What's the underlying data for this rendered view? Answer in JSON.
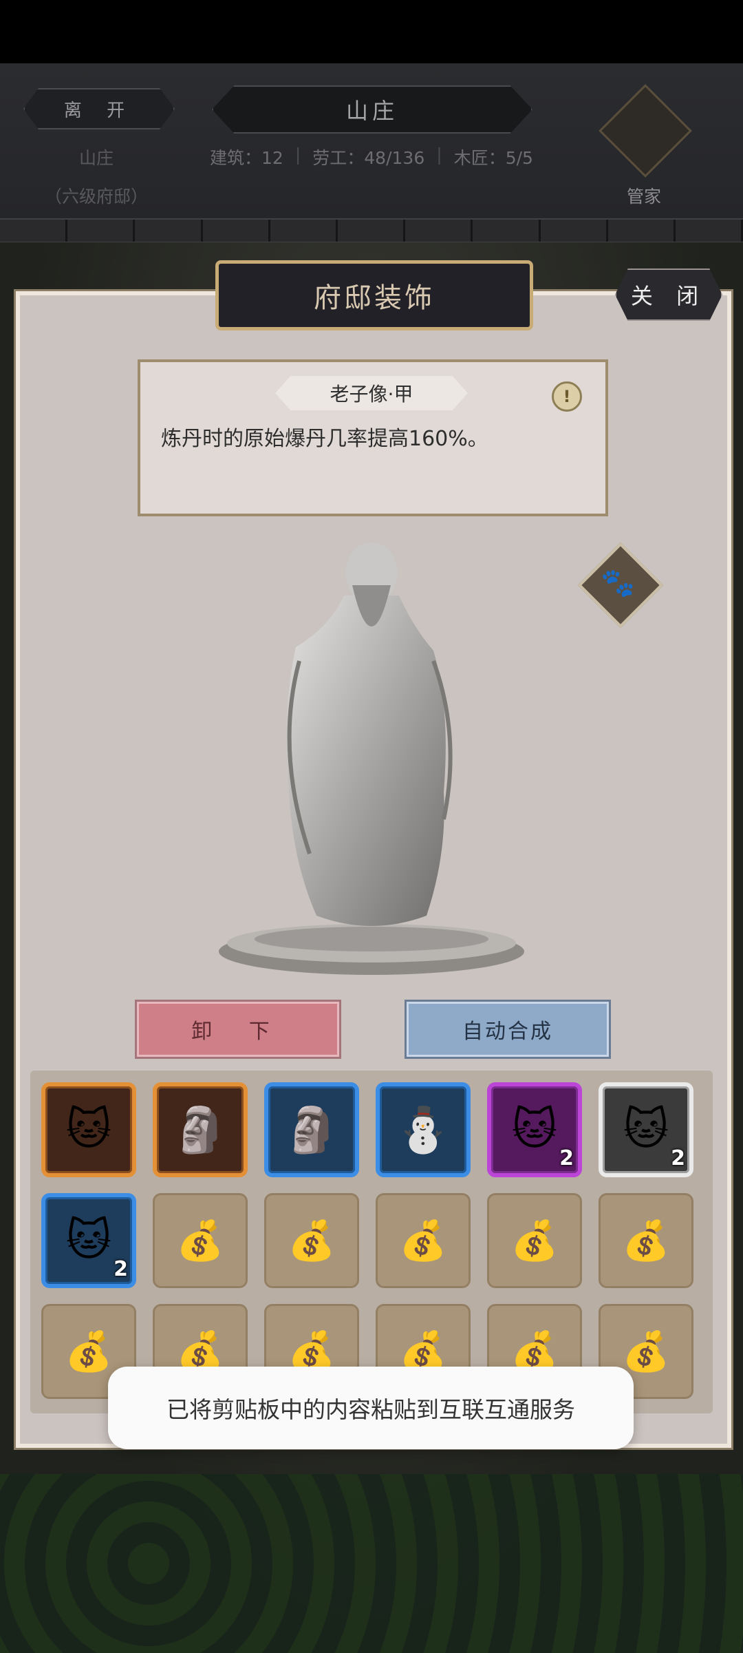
{
  "header": {
    "leave_label": "离 开",
    "estate_title": "山庄",
    "estate_name": "山庄",
    "estate_level": "（六级府邸）",
    "stats": {
      "buildings": "建筑：12",
      "labor": "劳工：48/136",
      "carpenters": "木匠：5/5"
    },
    "steward_label": "管家"
  },
  "panel": {
    "title": "府邸装饰",
    "close_label": "关 闭"
  },
  "item": {
    "name": "老子像·甲",
    "description": "炼丹时的原始爆丹几率提高160%。",
    "alert_symbol": "!"
  },
  "actions": {
    "unequip_label": "卸 下",
    "auto_merge_label": "自动合成"
  },
  "inventory": [
    {
      "icon": "lucky-cat-icon",
      "glyph": "🐱",
      "rarity": "orange",
      "count": ""
    },
    {
      "icon": "laozi-statue-icon",
      "glyph": "🗿",
      "rarity": "orange",
      "count": ""
    },
    {
      "icon": "statue-icon",
      "glyph": "🗿",
      "rarity": "blue",
      "count": ""
    },
    {
      "icon": "snowman-icon",
      "glyph": "⛄",
      "rarity": "blue",
      "count": ""
    },
    {
      "icon": "lucky-cat-icon",
      "glyph": "🐱",
      "rarity": "purple",
      "count": "2"
    },
    {
      "icon": "lucky-cat-icon",
      "glyph": "🐱",
      "rarity": "white",
      "count": "2"
    },
    {
      "icon": "lucky-cat-icon",
      "glyph": "🐱",
      "rarity": "blue",
      "count": "2"
    },
    {
      "icon": "money-bag-icon",
      "glyph": "💰",
      "rarity": "empty",
      "count": ""
    },
    {
      "icon": "money-bag-icon",
      "glyph": "💰",
      "rarity": "empty",
      "count": ""
    },
    {
      "icon": "money-bag-icon",
      "glyph": "💰",
      "rarity": "empty",
      "count": ""
    },
    {
      "icon": "money-bag-icon",
      "glyph": "💰",
      "rarity": "empty",
      "count": ""
    },
    {
      "icon": "money-bag-icon",
      "glyph": "💰",
      "rarity": "empty",
      "count": ""
    },
    {
      "icon": "money-bag-icon",
      "glyph": "💰",
      "rarity": "empty",
      "count": ""
    },
    {
      "icon": "money-bag-icon",
      "glyph": "💰",
      "rarity": "empty",
      "count": ""
    },
    {
      "icon": "money-bag-icon",
      "glyph": "💰",
      "rarity": "empty",
      "count": ""
    },
    {
      "icon": "money-bag-icon",
      "glyph": "💰",
      "rarity": "empty",
      "count": ""
    },
    {
      "icon": "money-bag-icon",
      "glyph": "💰",
      "rarity": "empty",
      "count": ""
    },
    {
      "icon": "money-bag-icon",
      "glyph": "💰",
      "rarity": "empty",
      "count": ""
    }
  ],
  "toast": {
    "message": "已将剪贴板中的内容粘贴到互联互通服务"
  },
  "colors": {
    "panel_bg": "#cbc3bf",
    "title_gold": "#c9ab76",
    "unequip_red": "#cf7f88",
    "auto_merge_blue": "#8fa9c8"
  }
}
